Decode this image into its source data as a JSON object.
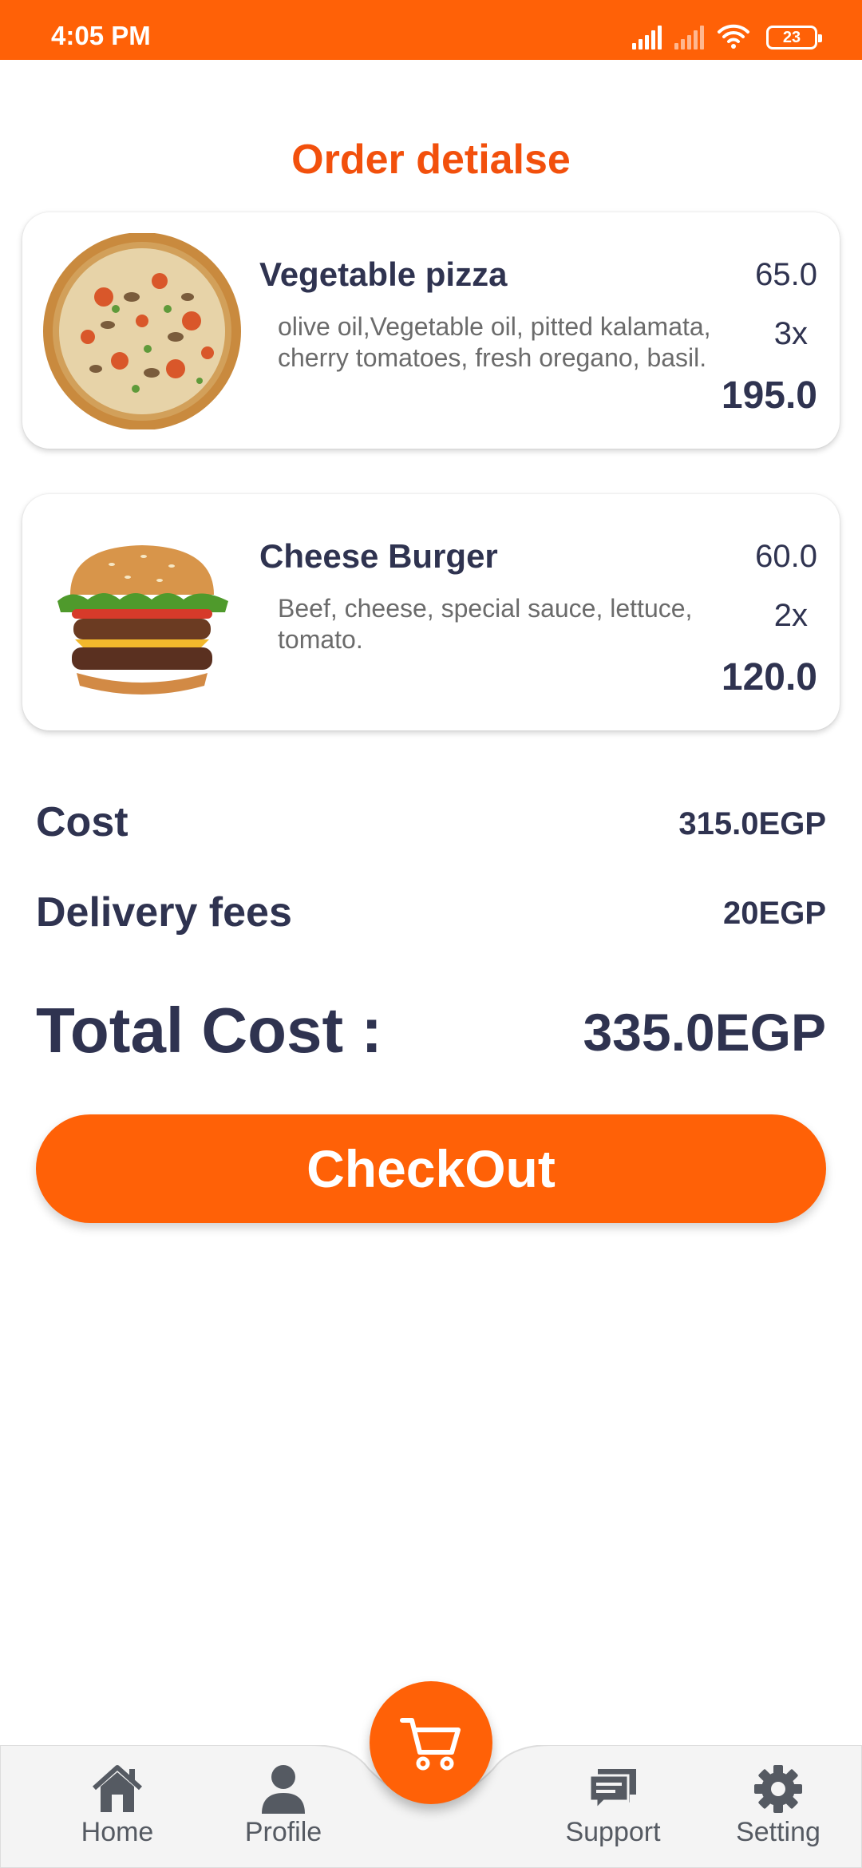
{
  "status_bar": {
    "time": "4:05 PM",
    "battery": "23",
    "icons": [
      "signal-icon",
      "signal-icon",
      "wifi-icon",
      "battery-icon"
    ]
  },
  "page": {
    "title": "Order detialse"
  },
  "items": [
    {
      "name": "Vegetable pizza",
      "description": "olive oil,Vegetable oil, pitted kalamata, cherry tomatoes, fresh oregano, basil.",
      "price": "65.0",
      "quantity": "3x",
      "total": "195.0",
      "image": "pizza-image"
    },
    {
      "name": "Cheese Burger",
      "description": "Beef, cheese, special sauce, lettuce, tomato.",
      "price": "60.0",
      "quantity": "2x",
      "total": "120.0",
      "image": "burger-image"
    }
  ],
  "summary": {
    "cost_label": "Cost",
    "cost_value": "315.0EGP",
    "fees_label": "Delivery fees",
    "fees_value": "20EGP",
    "total_label": "Total Cost :",
    "total_value": "335.0EGP"
  },
  "checkout": {
    "label": "CheckOut"
  },
  "nav": {
    "home": "Home",
    "profile": "Profile",
    "support": "Support",
    "setting": "Setting",
    "cart_icon": "cart-icon"
  },
  "colors": {
    "accent": "#ff6107",
    "title": "#f2500c",
    "text_dark": "#2f3350",
    "text_muted": "#6b6b6b",
    "nav_icon": "#555a62"
  }
}
